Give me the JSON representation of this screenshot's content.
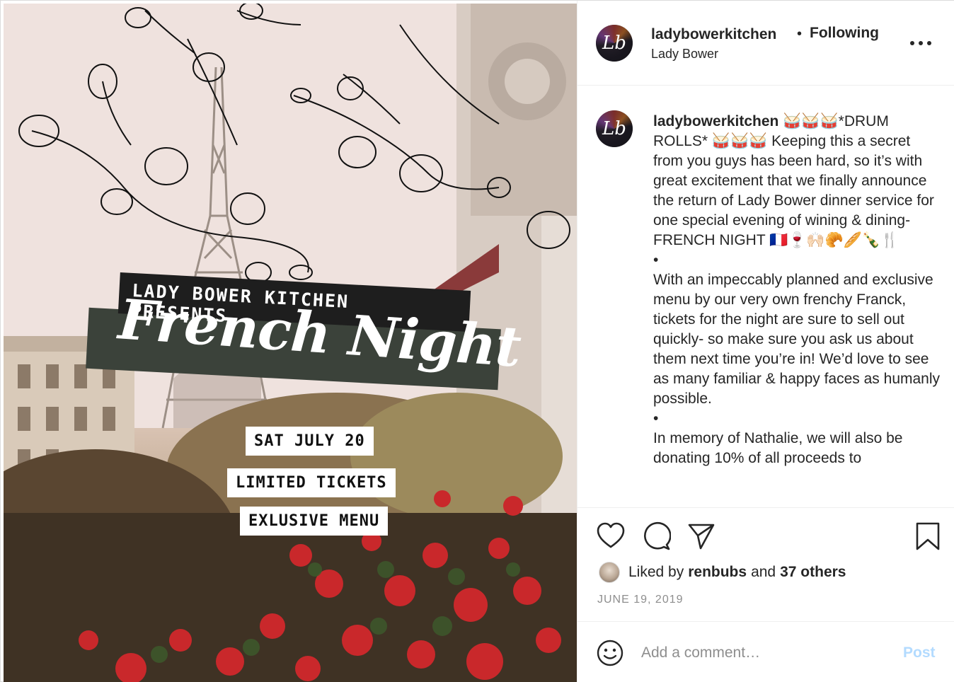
{
  "media": {
    "banner_presents": "LADY BOWER KITCHEN PRESENTS",
    "banner_title": "French Night",
    "tag_date": "SAT JULY 20",
    "tag_tickets": "LIMITED TICKETS",
    "tag_menu": "EXLUSIVE MENU"
  },
  "header": {
    "avatar_monogram": "Lb",
    "username": "ladybowerkitchen",
    "separator": "•",
    "follow_status": "Following",
    "location": "Lady Bower"
  },
  "caption": {
    "username": "ladybowerkitchen",
    "paragraph1": " 🥁🥁🥁*DRUM ROLLS* 🥁🥁🥁 Keeping this a secret from you guys has been hard, so it’s with great excitement that we finally announce the return of Lady Bower dinner service for one special evening of wining & dining- FRENCH NIGHT 🇫🇷🍷🙌🏻🥐🥖🍾🍴",
    "bullet1": "•",
    "paragraph2": "With an impeccably planned and exclusive menu by our very own frenchy Franck, tickets for the night are sure to sell out quickly- so make sure you ask us about them next time you’re in! We’d love to see as many familiar & happy faces as humanly possible.",
    "bullet2": "•",
    "paragraph3": "In memory of Nathalie, we will also be donating 10% of all proceeds to"
  },
  "likes": {
    "prefix": "Liked by",
    "user": "renbubs",
    "connector": "and",
    "others": "37 others"
  },
  "date": "JUNE 19, 2019",
  "comment": {
    "placeholder": "Add a comment…",
    "post_label": "Post"
  },
  "colors": {
    "post_button_disabled": "#b3dbff",
    "meta_gray": "#8e8e8e",
    "text": "#262626"
  }
}
